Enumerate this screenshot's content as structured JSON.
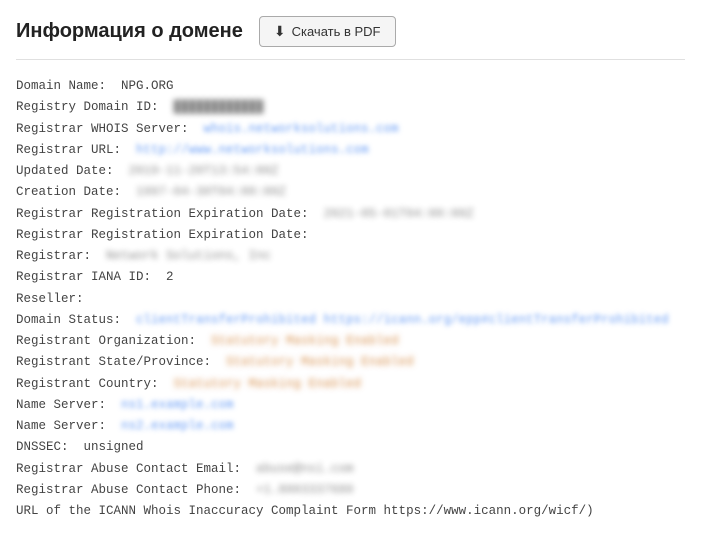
{
  "header": {
    "title": "Информация о домене",
    "pdf_button_label": "Скачать в PDF"
  },
  "whois": {
    "lines": [
      {
        "label": "Domain Name:  ",
        "value": "NPG.ORG",
        "style": "plain"
      },
      {
        "label": "Registry Domain ID:  ",
        "value": "████████████",
        "style": "blurred"
      },
      {
        "label": "Registrar WHOIS Server:  ",
        "value": "whois.networksolutions.com",
        "style": "link-blurred"
      },
      {
        "label": "Registrar URL:  ",
        "value": "http://www.networksolutions.com",
        "style": "link-blurred"
      },
      {
        "label": "Updated Date:  ",
        "value": "2019-11-20T13:54:00Z",
        "style": "blurred"
      },
      {
        "label": "Creation Date:  ",
        "value": "1997-04-30T04:00:00Z",
        "style": "blurred"
      },
      {
        "label": "Registrar Registration Expiration Date:  ",
        "value": "2021-05-01T04:00:00Z",
        "style": "blurred"
      },
      {
        "label": "Registrar Registration Expiration Date:  ",
        "value": "",
        "style": "plain"
      },
      {
        "label": "Registrar:  ",
        "value": "Network Solutions, Inc",
        "style": "blurred"
      },
      {
        "label": "Registrar IANA ID:  ",
        "value": "2",
        "style": "plain"
      },
      {
        "label": "Reseller:  ",
        "value": "",
        "style": "plain"
      },
      {
        "label": "Domain Status:  ",
        "value": "clientTransferProhibited https://icann.org/epp#clientTransferProhibited",
        "style": "link-blurred"
      },
      {
        "label": "Registrant Organization:  ",
        "value": "Statutory Masking Enabled",
        "style": "orange-blurred"
      },
      {
        "label": "Registrant State/Province:  ",
        "value": "Statutory Masking Enabled",
        "style": "orange-blurred"
      },
      {
        "label": "Registrant Country:  ",
        "value": "Statutory Masking Enabled",
        "style": "orange-blurred"
      },
      {
        "label": "Name Server:  ",
        "value": "ns1.example.com",
        "style": "link-blurred"
      },
      {
        "label": "Name Server:  ",
        "value": "ns2.example.com",
        "style": "link-blurred"
      },
      {
        "label": "DNSSEC:  ",
        "value": "unsigned",
        "style": "plain"
      },
      {
        "label": "Registrar Abuse Contact Email:  ",
        "value": "abuse@nsi.com",
        "style": "blurred"
      },
      {
        "label": "Registrar Abuse Contact Phone:  ",
        "value": "+1.8003337680",
        "style": "blurred"
      },
      {
        "label": "URL of the ICANN Whois Inaccuracy Complaint Form https://www.icann.org/wicf/)",
        "value": "",
        "style": "plain"
      }
    ]
  }
}
